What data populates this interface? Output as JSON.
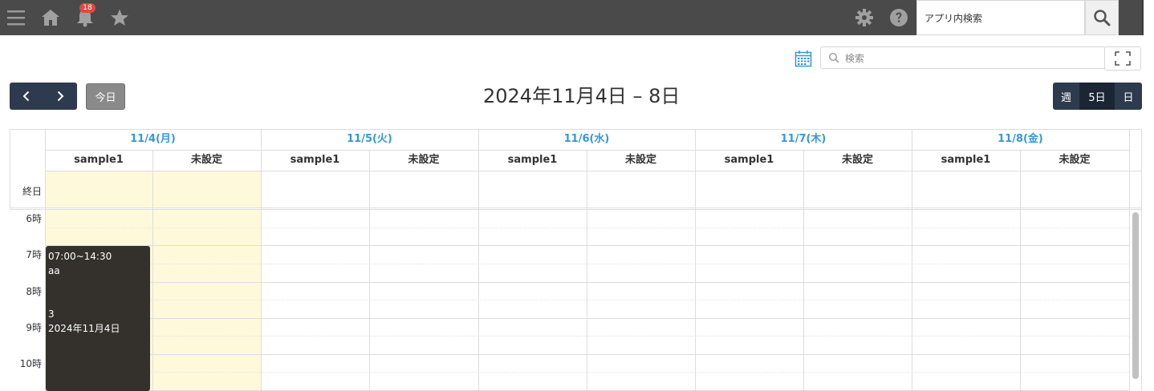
{
  "header": {
    "notification_count": "18",
    "app_search_placeholder": "アプリ内検索"
  },
  "toolbar": {
    "search_placeholder": "検索"
  },
  "nav": {
    "today_label": "今日",
    "date_range_title": "2024年11月4日 – 8日",
    "views": [
      {
        "label": "週",
        "active": false
      },
      {
        "label": "5日",
        "active": true
      },
      {
        "label": "日",
        "active": false
      }
    ]
  },
  "calendar": {
    "allday_label": "終日",
    "days": [
      {
        "label": "11/4(月)",
        "columns": [
          "sample1",
          "未設定"
        ]
      },
      {
        "label": "11/5(火)",
        "columns": [
          "sample1",
          "未設定"
        ]
      },
      {
        "label": "11/6(水)",
        "columns": [
          "sample1",
          "未設定"
        ]
      },
      {
        "label": "11/7(木)",
        "columns": [
          "sample1",
          "未設定"
        ]
      },
      {
        "label": "11/8(金)",
        "columns": [
          "sample1",
          "未設定"
        ]
      }
    ],
    "hours": [
      "6時",
      "7時",
      "8時",
      "9時",
      "10時"
    ],
    "event": {
      "time": "07:00~14:30",
      "title": "aa",
      "line3": "3",
      "date": "2024年11月4日"
    }
  },
  "colors": {
    "header_bg": "#4a4a4a",
    "nav_btn": "#2e3b4e",
    "day_header_text": "#3498db",
    "highlight_bg": "#fff9db",
    "event_bg": "#34312c",
    "badge": "#e04a3c"
  }
}
